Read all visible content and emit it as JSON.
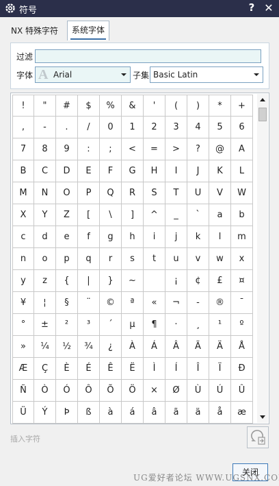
{
  "window": {
    "title": "符号",
    "help_glyph": "?",
    "close_glyph": "✕"
  },
  "tabs": [
    {
      "label": "NX 特殊字符",
      "active": false
    },
    {
      "label": "系统字体",
      "active": true
    }
  ],
  "filter": {
    "label": "过滤",
    "value": "",
    "placeholder": ""
  },
  "font": {
    "label": "字体",
    "glyph": "A",
    "value": "Arial"
  },
  "subset": {
    "label": "子集",
    "value": "Basic Latin"
  },
  "characters": [
    "!",
    "\"",
    "#",
    "$",
    "%",
    "&",
    "'",
    "(",
    ")",
    "*",
    "+",
    ",",
    "-",
    ".",
    "/",
    "0",
    "1",
    "2",
    "3",
    "4",
    "5",
    "6",
    "7",
    "8",
    "9",
    ":",
    ";",
    "<",
    "=",
    ">",
    "?",
    "@",
    "A",
    "B",
    "C",
    "D",
    "E",
    "F",
    "G",
    "H",
    "I",
    "J",
    "K",
    "L",
    "M",
    "N",
    "O",
    "P",
    "Q",
    "R",
    "S",
    "T",
    "U",
    "V",
    "W",
    "X",
    "Y",
    "Z",
    "[",
    "\\",
    "]",
    "^",
    "_",
    "`",
    "a",
    "b",
    "c",
    "d",
    "e",
    "f",
    "g",
    "h",
    "i",
    "j",
    "k",
    "l",
    "m",
    "n",
    "o",
    "p",
    "q",
    "r",
    "s",
    "t",
    "u",
    "v",
    "w",
    "x",
    "y",
    "z",
    "{",
    "|",
    "}",
    "~",
    "",
    "¡",
    "¢",
    "£",
    "¤",
    "¥",
    "¦",
    "§",
    "¨",
    "©",
    "ª",
    "«",
    "¬",
    "-",
    "®",
    "¯",
    "°",
    "±",
    "²",
    "³",
    "´",
    "µ",
    "¶",
    "·",
    "¸",
    "¹",
    "º",
    "»",
    "¼",
    "½",
    "¾",
    "¿",
    "À",
    "Á",
    "Â",
    "Ã",
    "Ä",
    "Å",
    "Æ",
    "Ç",
    "È",
    "É",
    "Ê",
    "Ë",
    "Ì",
    "Í",
    "Î",
    "Ï",
    "Ð",
    "Ñ",
    "Ò",
    "Ó",
    "Ô",
    "Õ",
    "Ö",
    "×",
    "Ø",
    "Ù",
    "Ú",
    "Û",
    "Ü",
    "Ý",
    "Þ",
    "ß",
    "à",
    "á",
    "â",
    "ã",
    "ä",
    "å",
    "æ"
  ],
  "insert": {
    "label": "插入字符",
    "icon": "omega-insert-icon"
  },
  "buttons": {
    "close_label": "关闭"
  },
  "watermark": "UG爱好者论坛 WWW.UGSNX.COM",
  "colors": {
    "titlebar": "#2b2f4a",
    "field_bg": "#eaf6f6",
    "accent": "#3a78b8"
  }
}
